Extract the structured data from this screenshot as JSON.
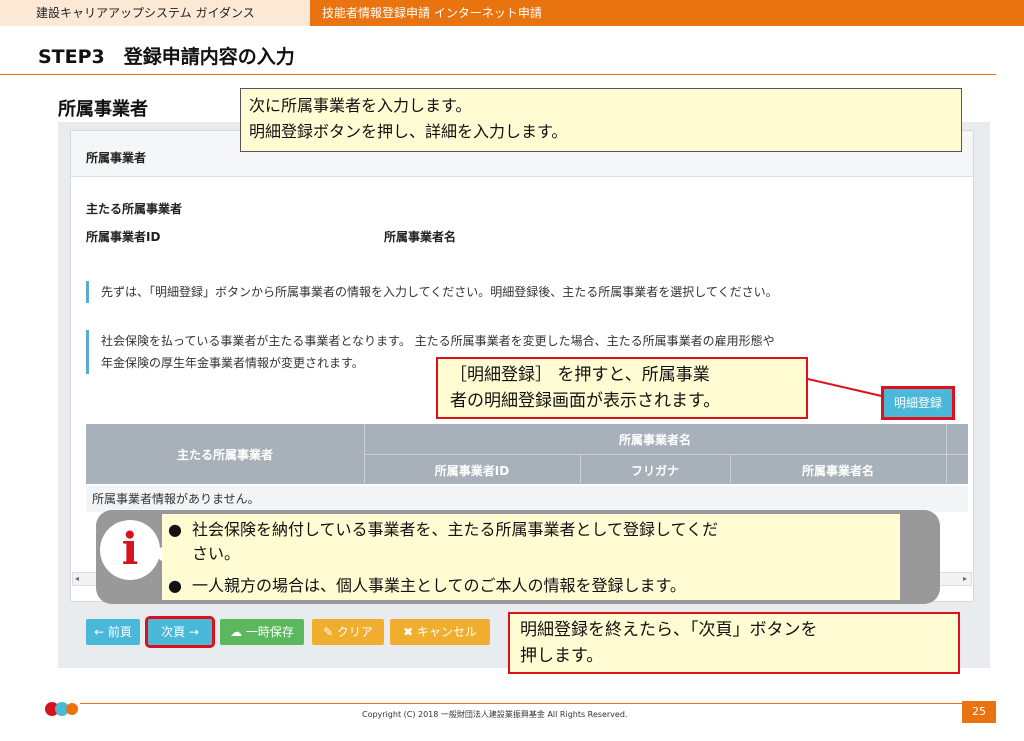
{
  "header": {
    "guide_title": "建設キャリアアップシステム ガイダンス",
    "section": "技能者情報登録申請 インターネット申請"
  },
  "page": {
    "step_title": "STEP3　登録申請内容の入力",
    "section_title": "所属事業者",
    "page_number": "25",
    "copyright": "Copyright (C) 2018 一般財団法人建設業振興基金 All Rights Reserved."
  },
  "panel": {
    "title": "所属事業者",
    "main_label": "主たる所属事業者",
    "id_label": "所属事業者ID",
    "name_label": "所属事業者名",
    "notice1": "先ずは、「明細登録」ボタンから所属事業者の情報を入力してください。明細登録後、主たる所属事業者を選択してください。",
    "notice2_line1": "社会保険を払っている事業者が主たる事業者となります。 主たる所属事業者を変更した場合、主たる所属事業者の雇用形態や",
    "notice2_line2": "年金保険の厚生年金事業者情報が変更されます。",
    "detail_button": "明細登録"
  },
  "table": {
    "col_main": "主たる所属事業者",
    "group_header": "所属事業者名",
    "col_id": "所属事業者ID",
    "col_kana": "フリガナ",
    "col_name": "所属事業者名",
    "empty_message": "所属事業者情報がありません。"
  },
  "buttons": {
    "prev": "← 前頁",
    "next": "次頁 →",
    "save": "☁ 一時保存",
    "clear": "✎ クリア",
    "cancel": "✖ キャンセル"
  },
  "callouts": {
    "top_line1": "次に所属事業者を入力します。",
    "top_line2": "明細登録ボタンを押し、詳細を入力します。",
    "detail_line1": "［明細登録］ を押すと、所属事業",
    "detail_line2": "者の明細登録画面が表示されます。",
    "next_line1": "明細登録を終えたら、「次頁」ボタンを",
    "next_line2": "押します。"
  },
  "info": {
    "icon": "i",
    "bullet1_line1": "社会保険を納付している事業者を、主たる所属事業者として登録してくだ",
    "bullet1_line2": "さい。",
    "bullet2": "一人親方の場合は、個人事業主としてのご本人の情報を登録します。",
    "dot": "●"
  },
  "colors": {
    "brand_orange": "#e8730f",
    "accent_blue": "#4ab8d8",
    "highlight_red": "#e0101a",
    "callout_yellow": "#fffbd2"
  }
}
